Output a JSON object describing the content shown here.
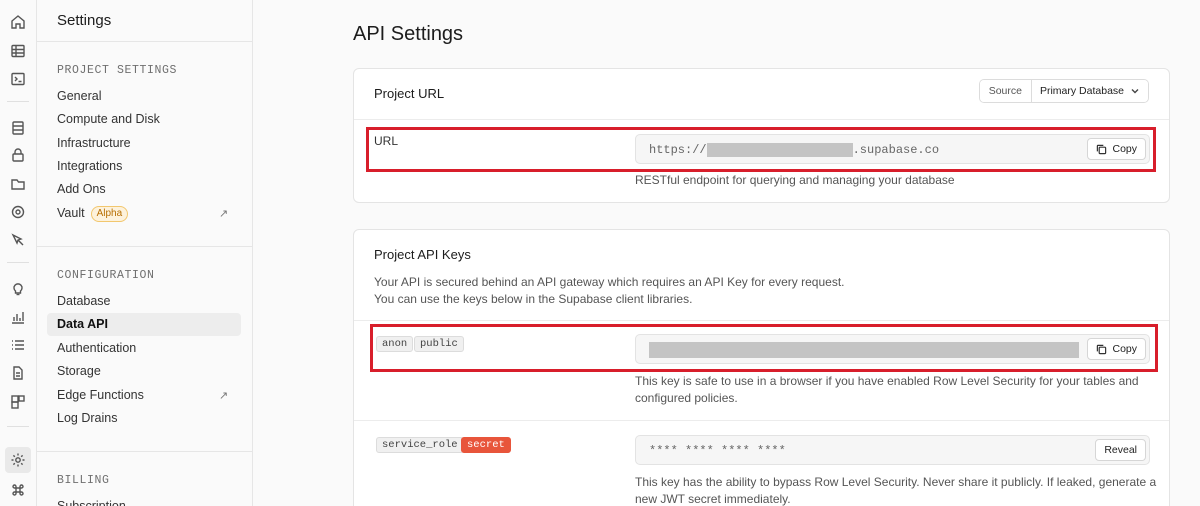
{
  "rail": {
    "icons": [
      "home-icon",
      "table-editor-icon",
      "sql-editor-icon",
      "database-icon",
      "auth-icon",
      "storage-icon",
      "realtime-icon",
      "edge-functions-icon",
      "advisors-icon",
      "reports-icon",
      "logs-icon",
      "docs-icon",
      "integrations-icon",
      "settings-icon",
      "command-icon"
    ]
  },
  "sidebar": {
    "title": "Settings",
    "project_section": "PROJECT SETTINGS",
    "project_items": [
      "General",
      "Compute and Disk",
      "Infrastructure",
      "Integrations",
      "Add Ons",
      "Vault"
    ],
    "vault_badge": "Alpha",
    "config_section": "CONFIGURATION",
    "config_items": [
      "Database",
      "Data API",
      "Authentication",
      "Storage",
      "Edge Functions",
      "Log Drains"
    ],
    "billing_section": "BILLING",
    "billing_items": [
      "Subscription"
    ],
    "ext_glyph": "↗"
  },
  "main": {
    "page_title": "API Settings",
    "project_url": {
      "heading": "Project URL",
      "source_label": "Source",
      "source_value": "Primary Database",
      "row_label": "URL",
      "url_prefix": "https://",
      "url_suffix": ".supabase.co",
      "copy_label": "Copy",
      "description": "RESTful endpoint for querying and managing your database"
    },
    "api_keys": {
      "heading": "Project API Keys",
      "desc1": "Your API is secured behind an API gateway which requires an API Key for every request.",
      "desc2": "You can use the keys below in the Supabase client libraries.",
      "anon_tag1": "anon",
      "anon_tag2": "public",
      "anon_copy": "Copy",
      "anon_desc1": "This key is safe to use in a browser if you have enabled Row Level Security for your tables and",
      "anon_desc2": "configured policies.",
      "service_tag1": "service_role",
      "service_tag2": "secret",
      "service_masked": "**** **** **** ****",
      "reveal_label": "Reveal",
      "service_desc1": "This key has the ability to bypass Row Level Security. Never share it publicly. If leaked, generate a",
      "service_desc2": "new JWT secret immediately."
    }
  },
  "colors": {
    "highlight": "#d81e2b",
    "secret_tag": "#e8553b",
    "alpha_badge": "#b76e00"
  }
}
